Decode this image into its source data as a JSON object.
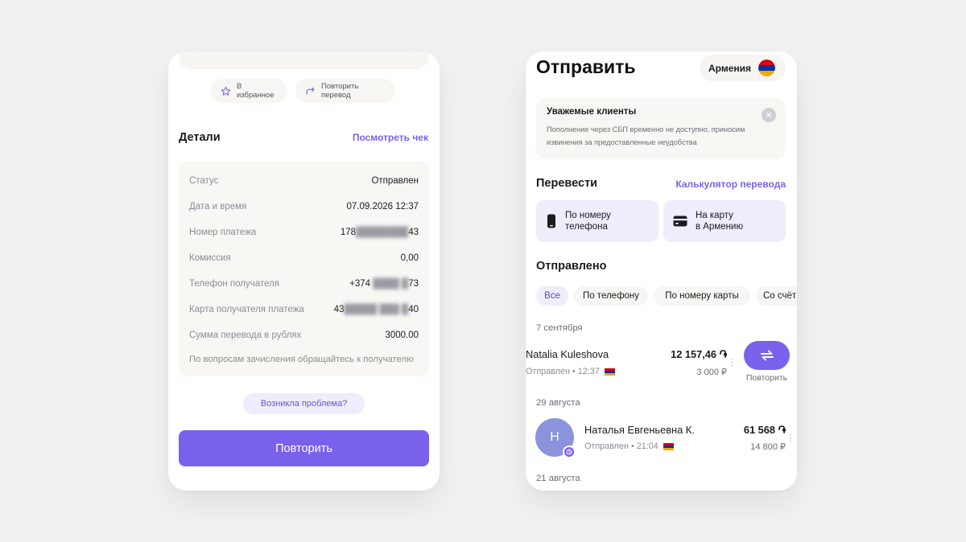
{
  "left": {
    "favorite_label": "В избранное",
    "repeat_transfer_label": "Повторить перевод",
    "details_title": "Детали",
    "view_receipt_label": "Посмотреть чек",
    "rows": [
      {
        "label": "Статус",
        "value": "Отправлен"
      },
      {
        "label": "Дата и время",
        "value": "07.09.2026 12:37"
      },
      {
        "label": "Номер платежа",
        "value_prefix": "178",
        "value_suffix": "43"
      },
      {
        "label": "Комиссия",
        "value": "0,00"
      },
      {
        "label": "Телефон получателя",
        "value_prefix": "+374",
        "value_suffix": "73"
      },
      {
        "label": "Карта получателя платежа",
        "value_prefix": "43",
        "value_suffix": "40"
      },
      {
        "label": "Сумма перевода в рублях",
        "value": "3000.00"
      }
    ],
    "note": "По вопросам зачисления обращайтесь к получателю",
    "problem_label": "Возникла проблема?",
    "repeat_label": "Повторить"
  },
  "right": {
    "title": "Отправить",
    "country": "Армения",
    "notice_title": "Уважемые клиенты",
    "notice_text": "Пополнение через СБП временно не доступно, приносим извинения за предоставленные неудобства",
    "transfer_title": "Перевести",
    "calc_label": "Калькулятор перевода",
    "tile_phone_line1": "По номеру",
    "tile_phone_line2": "телефона",
    "tile_card_line1": "На карту",
    "tile_card_line2": "в Армению",
    "sent_title": "Отправлено",
    "filters": [
      "Все",
      "По телефону",
      "По номеру карты",
      "Со счёт"
    ],
    "groups": [
      {
        "date": "7 сентября",
        "tx": {
          "name": "Natalia Kuleshova",
          "status": "Отправлен • 12:37",
          "amount": "12 157,46 ֏",
          "sub": "3 000 ₽",
          "action_label": "Повторить"
        }
      },
      {
        "date": "29 августа",
        "tx": {
          "name": "Наталья Евгеньевна К.",
          "status": "Отправлен • 21:04",
          "amount": "61 568 ֏",
          "sub": "14 800 ₽",
          "avatar": "Н"
        }
      },
      {
        "date": "21 августа"
      }
    ]
  },
  "colors": {
    "accent": "#7a61ec",
    "accent_soft": "#efecfb",
    "flag_red": "#d90012",
    "flag_blue": "#0033a0",
    "flag_orange": "#f2a800"
  }
}
